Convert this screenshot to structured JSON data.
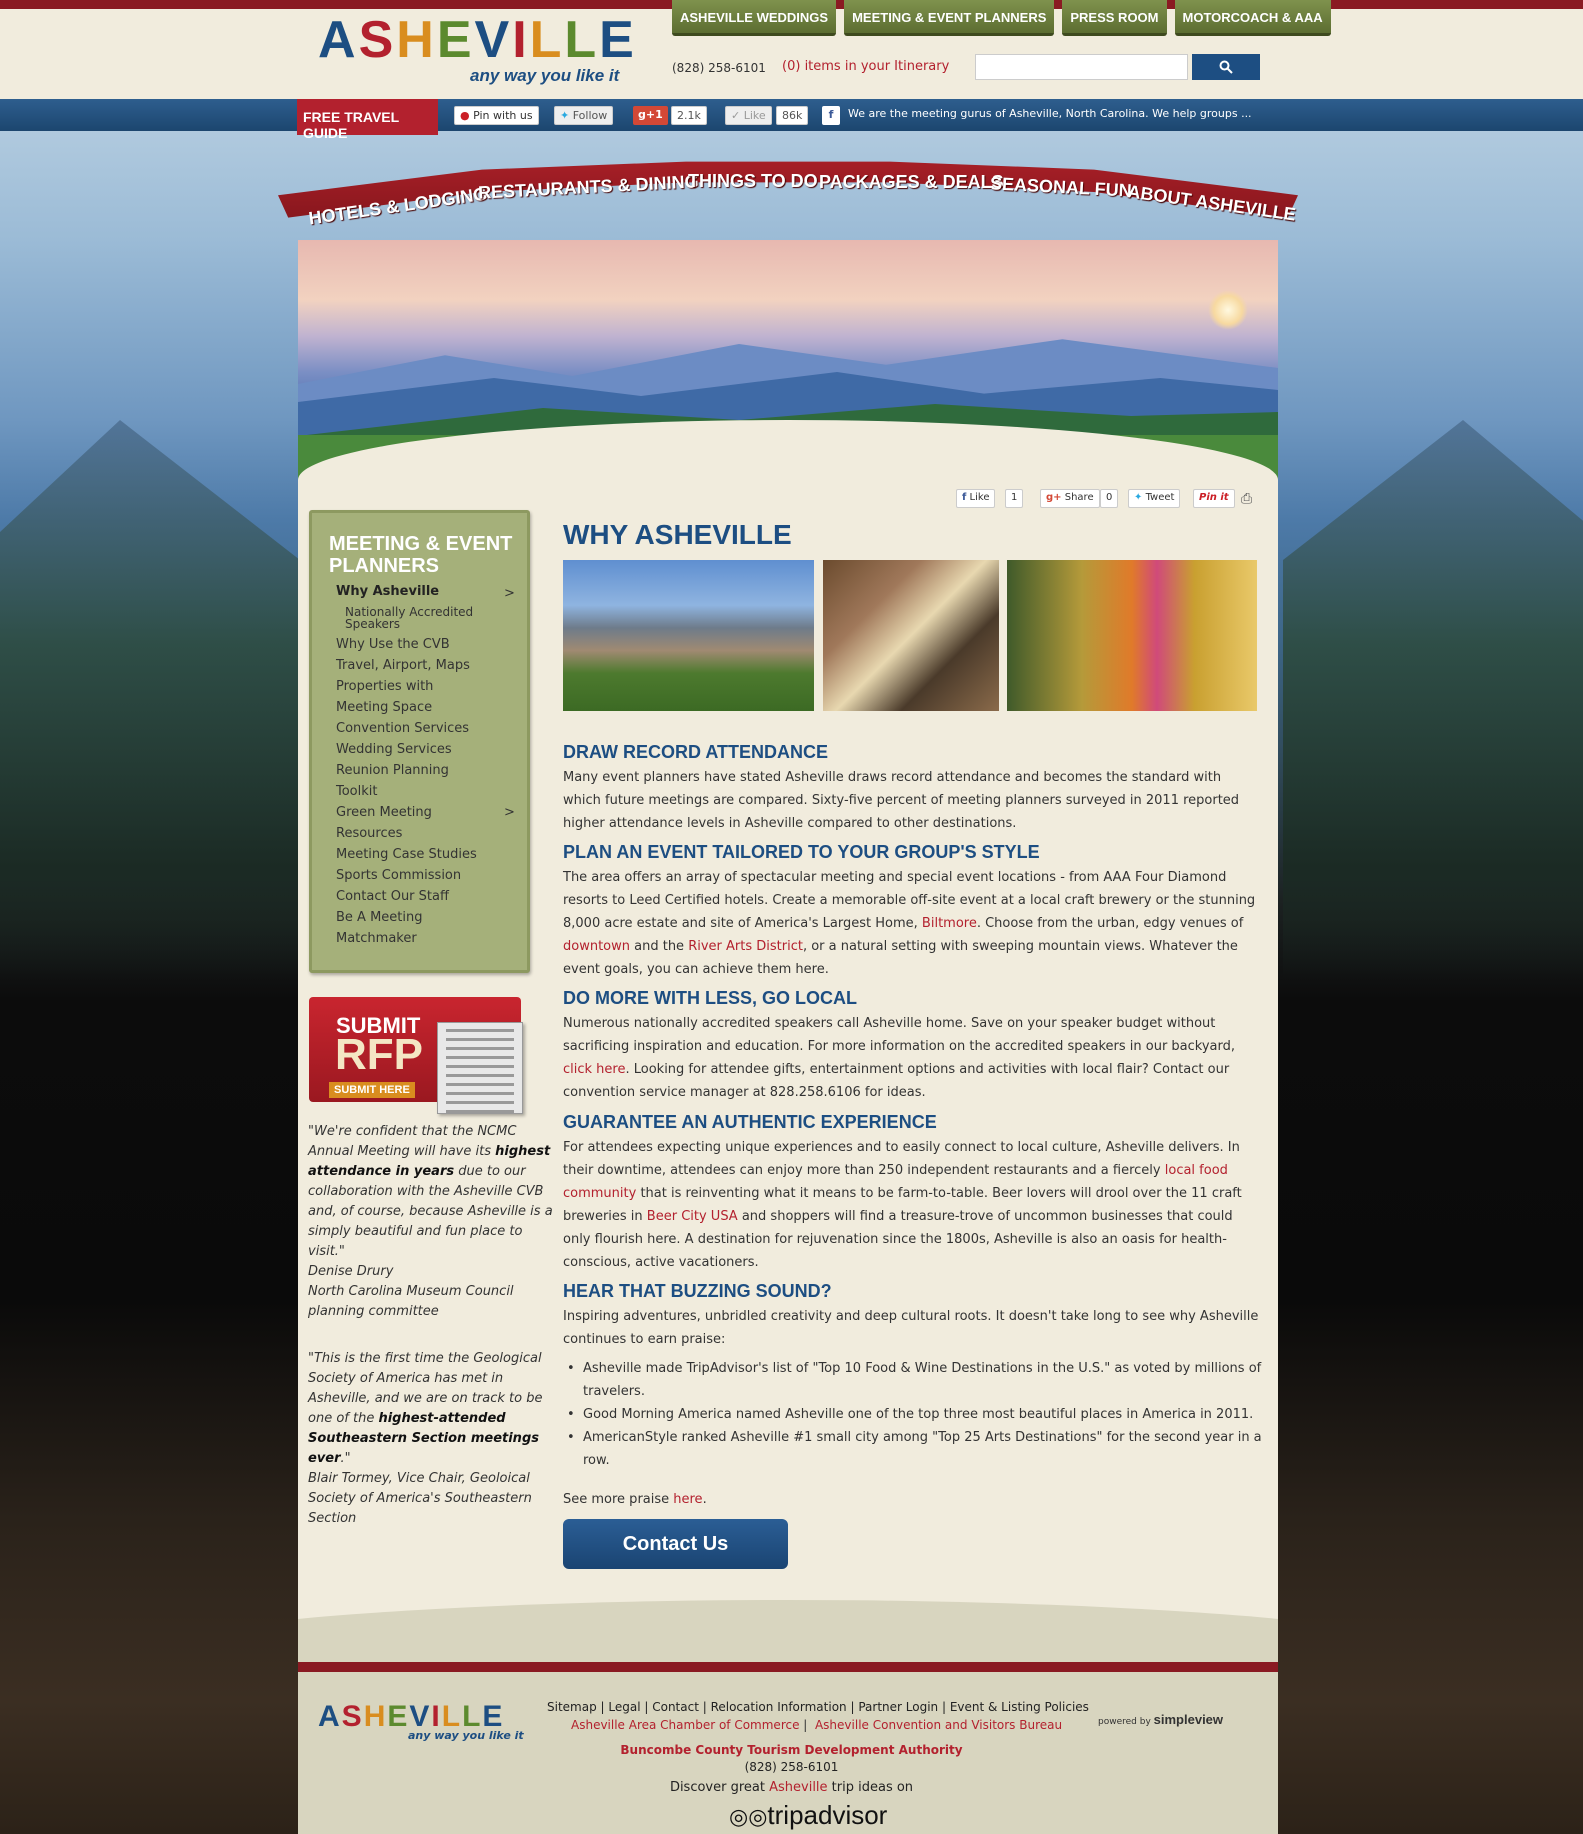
{
  "header": {
    "logo_text": "ASHEVILLE",
    "logo_tagline": "any way you like it",
    "phone": "(828) 258-6101",
    "itinerary_count": "(0)",
    "itinerary_text": "items in your Itinerary",
    "search_placeholder": "",
    "top_tabs": [
      "ASHEVILLE WEDDINGS",
      "MEETING & EVENT PLANNERS",
      "PRESS ROOM",
      "MOTORCOACH & AAA"
    ]
  },
  "social_bar": {
    "travel_guide": "FREE TRAVEL GUIDE",
    "pin": "Pin with us",
    "follow": "Follow",
    "gplus": "g+1",
    "gplus_count": "2.1k",
    "like": "Like",
    "like_count": "86k",
    "facebook_icon": "f",
    "facebook_text": "We are the meeting gurus of Asheville, North Carolina. We help groups ..."
  },
  "main_nav": [
    "HOTELS & LODGING",
    "RESTAURANTS & DINING",
    "THINGS TO DO",
    "PACKAGES & DEALS",
    "SEASONAL FUN",
    "ABOUT ASHEVILLE"
  ],
  "share_tools": {
    "fb_like": "Like",
    "fb_count": "1",
    "gshare": "Share",
    "gshare_count": "0",
    "tweet": "Tweet",
    "pinit": "Pin it"
  },
  "sidebar": {
    "title": "MEETING & EVENT PLANNERS",
    "current": "Why Asheville",
    "sub_item": "Nationally Accredited Speakers",
    "items": [
      "Why Use the CVB",
      "Travel, Airport, Maps",
      "Properties with",
      "Meeting Space",
      "Convention Services",
      "Wedding Services",
      "Reunion Planning",
      "Toolkit",
      "Green Meeting",
      "Resources",
      "Meeting Case Studies",
      "Sports Commission",
      "Contact Our Staff",
      "Be A Meeting",
      "Matchmaker"
    ],
    "arrow": ">"
  },
  "rfp": {
    "line1": "SUBMIT",
    "line2": "RFP",
    "line3": "SUBMIT HERE"
  },
  "quotes": [
    {
      "pre": "\"We're confident that the NCMC Annual Meeting will have its ",
      "bold": "highest attendance in years",
      "post": " due to our collaboration with the Asheville CVB and, of course, because Asheville is a simply beautiful and fun place to visit.\"",
      "author": "Denise Drury",
      "affiliation": "North Carolina Museum Council planning committee"
    },
    {
      "pre": "\"This is the first time the Geological Society of America has met in Asheville, and we are on track to be one of the ",
      "bold": "highest-attended Southeastern Section meetings ever",
      "post": ".\"",
      "author": "Blair Tormey, Vice Chair, Geoloical Society of America's Southeastern Section",
      "affiliation": ""
    }
  ],
  "main": {
    "title": "WHY ASHEVILLE",
    "sections": [
      {
        "heading": "DRAW RECORD ATTENDANCE",
        "text": "Many event planners have stated Asheville draws record attendance and becomes the standard with which future meetings are compared. Sixty-five percent of meeting planners surveyed in 2011 reported higher attendance levels in Asheville compared to other destinations."
      },
      {
        "heading": "PLAN AN EVENT TAILORED TO YOUR GROUP'S STYLE",
        "t1": "The area offers an array of spectacular meeting and special event locations - from AAA Four Diamond resorts to Leed Certified hotels. Create a memorable off-site event at a local craft brewery or the stunning 8,000 acre estate and site of America's Largest Home, ",
        "l1": "Biltmore",
        "t2": ". Choose from the urban, edgy venues of ",
        "l2": "downtown",
        "t3": " and the ",
        "l3": "River Arts District",
        "t4": ", or a natural setting with sweeping mountain views. Whatever the event goals, you can achieve them here."
      },
      {
        "heading": "DO MORE WITH LESS, GO LOCAL",
        "t1": "Numerous nationally accredited speakers call Asheville home. Save on your speaker budget without sacrificing inspiration and education. For more information on the accredited speakers in our backyard, ",
        "l1": "click here",
        "t2": ". Looking for attendee gifts, entertainment options and activities with local flair? Contact our convention service manager at 828.258.6106 for ideas."
      },
      {
        "heading": "GUARANTEE AN AUTHENTIC EXPERIENCE",
        "t1": "For attendees expecting unique experiences and to easily connect to local culture, Asheville delivers. In their downtime, attendees can enjoy more than 250 independent restaurants and a fiercely ",
        "l1": "local food community",
        "t2": " that is reinventing what it means to be farm-to-table. Beer lovers will drool over the 11 craft breweries in ",
        "l2": "Beer City USA",
        "t3": " and shoppers will find a treasure-trove of uncommon businesses that could only flourish here. A destination for rejuvenation since the 1800s, Asheville is also an oasis for health-conscious, active vacationers."
      },
      {
        "heading": "HEAR THAT BUZZING SOUND?",
        "text": "Inspiring adventures, unbridled creativity and deep cultural roots. It doesn't take long to see why Asheville continues to earn praise:"
      }
    ],
    "bullets": [
      "Asheville made TripAdvisor's list of \"Top 10 Food & Wine Destinations in the U.S.\" as voted by millions of travelers.",
      "Good Morning America named Asheville one of the top three most beautiful places in America in 2011.",
      "AmericanStyle ranked Asheville #1 small city among \"Top 25 Arts Destinations\" for the second year in a row."
    ],
    "praise_pre": "See more praise ",
    "praise_link": "here",
    "praise_post": ".",
    "contact_button": "Contact Us"
  },
  "footer": {
    "logo_text": "ASHEVILLE",
    "logo_tagline": "any way you like it",
    "links": [
      "Sitemap",
      "Legal",
      "Contact",
      "Relocation Information",
      "Partner Login",
      "Event & Listing Policies"
    ],
    "links2": [
      "Asheville Area Chamber of Commerce",
      "Asheville Convention and Visitors Bureau"
    ],
    "authority": "Buncombe County Tourism Development Authority",
    "phone": "(828) 258-6101",
    "discover_pre": "Discover great ",
    "discover_link": "Asheville",
    "discover_post": " trip ideas on",
    "tripadvisor": "tripadvisor",
    "powered_pre": "powered by",
    "powered_brand": "simpleview"
  },
  "colors": {
    "brand_red": "#b3212e",
    "brand_blue": "#1d4e82",
    "sidebar_green": "#a5b07a",
    "page_bg": "#f1ecdd"
  }
}
